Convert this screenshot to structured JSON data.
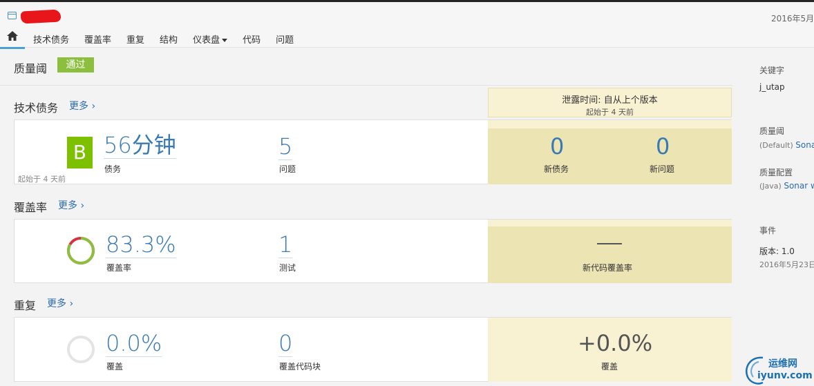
{
  "header": {
    "date": "2016年5月2",
    "nav": [
      "技术债务",
      "覆盖率",
      "重复",
      "结构",
      "仪表盘",
      "代码",
      "问题"
    ]
  },
  "quality_gate": {
    "title": "质量阈",
    "status": "通过"
  },
  "leak_period": {
    "title": "泄露时间: 自从上个版本",
    "subtitle": "起始于 4 天前"
  },
  "tech_debt": {
    "title": "技术债务",
    "more": "更多 ›",
    "rating": "B",
    "debt_value": "56分钟",
    "debt_label": "债务",
    "issues_value": "5",
    "issues_label": "问题",
    "since": "起始于 4 天前",
    "new_debt_value": "0",
    "new_debt_label": "新债务",
    "new_issues_value": "0",
    "new_issues_label": "新问题"
  },
  "coverage": {
    "title": "覆盖率",
    "more": "更多 ›",
    "value": "83.3%",
    "value_fraction": 0.833,
    "label": "覆盖率",
    "tests_value": "1",
    "tests_label": "测试",
    "new_value": "—",
    "new_label": "新代码覆盖率"
  },
  "duplication": {
    "title": "重复",
    "more": "更多 ›",
    "value": "0.0%",
    "value_fraction": 0.0,
    "label": "覆盖",
    "blocks_value": "0",
    "blocks_label": "覆盖代码块",
    "new_value": "+0.0%",
    "new_label": "覆盖"
  },
  "sidebar": {
    "key_label": "关键字",
    "key_value": "j_utap",
    "qg_label": "质量阈",
    "qg_default": "(Default)",
    "qg_link": "Sona",
    "profile_label": "质量配置",
    "profile_lang": "(Java)",
    "profile_link": "Sonar w",
    "events_label": "事件",
    "version": "版本: 1.0",
    "event_date": "2016年5月23日"
  },
  "watermark": {
    "line1": "运维网",
    "line2": "iyunv.com"
  },
  "colors": {
    "accent": "#3a7ab4",
    "pass": "#8cbf3e",
    "rating_b": "#7cc000",
    "leak": "#ede4b4",
    "coverage_green": "#8cbf3e",
    "coverage_red": "#d4333f"
  }
}
